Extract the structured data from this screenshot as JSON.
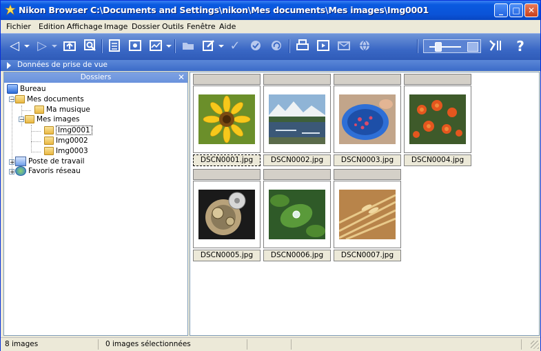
{
  "window": {
    "title": "Nikon Browser C:\\Documents and Settings\\nikon\\Mes documents\\Mes images\\Img0001",
    "min_glyph": "_",
    "max_glyph": "□",
    "close_glyph": "✕"
  },
  "menu": [
    "Fichier",
    "Edition",
    "Affichage",
    "Image",
    "Dossier",
    "Outils",
    "Fenêtre",
    "Aide"
  ],
  "toolbar": {
    "icons": [
      "back-icon",
      "forward-icon",
      "up-folder-icon",
      "zoom-icon",
      "view-icon",
      "view-mode-icon",
      "filter-icon",
      "open-folder-icon",
      "edit-icon",
      "check-icon",
      "protect-icon",
      "rotate-icon",
      "print-icon",
      "slideshow-icon",
      "mail-icon",
      "web-icon",
      "thumbnail-size-slider",
      "preferences-icon",
      "help-icon"
    ],
    "help_glyph": "?"
  },
  "infobar": {
    "label": "Données de prise de vue"
  },
  "folders_panel": {
    "header": "Dossiers",
    "close_glyph": "✕",
    "tree": [
      {
        "label": "Bureau"
      },
      {
        "label": "Mes documents"
      },
      {
        "label": "Ma musique"
      },
      {
        "label": "Mes images"
      },
      {
        "label": "Img0001",
        "selected": true
      },
      {
        "label": "Img0002"
      },
      {
        "label": "Img0003"
      },
      {
        "label": "Poste de travail"
      },
      {
        "label": "Favoris réseau"
      }
    ]
  },
  "thumbnails": [
    {
      "filename": "DSCN0001.jpg",
      "selected": true,
      "subject": "sunflower"
    },
    {
      "filename": "DSCN0002.jpg",
      "subject": "mountain-lake"
    },
    {
      "filename": "DSCN0003.jpg",
      "subject": "berries-in-blue-bowl"
    },
    {
      "filename": "DSCN0004.jpg",
      "subject": "orange-lilies"
    },
    {
      "filename": "DSCN0005.jpg",
      "subject": "watch-movement"
    },
    {
      "filename": "DSCN0006.jpg",
      "subject": "leaf-water-drop"
    },
    {
      "filename": "DSCN0007.jpg",
      "subject": "wheat"
    }
  ],
  "status": {
    "count": "8 images",
    "selected": "0 images sélectionnées"
  },
  "colors": {
    "titlebar": "#0a53d8",
    "toolbar": "#3a68c5",
    "panel_border": "#7f9db9"
  }
}
